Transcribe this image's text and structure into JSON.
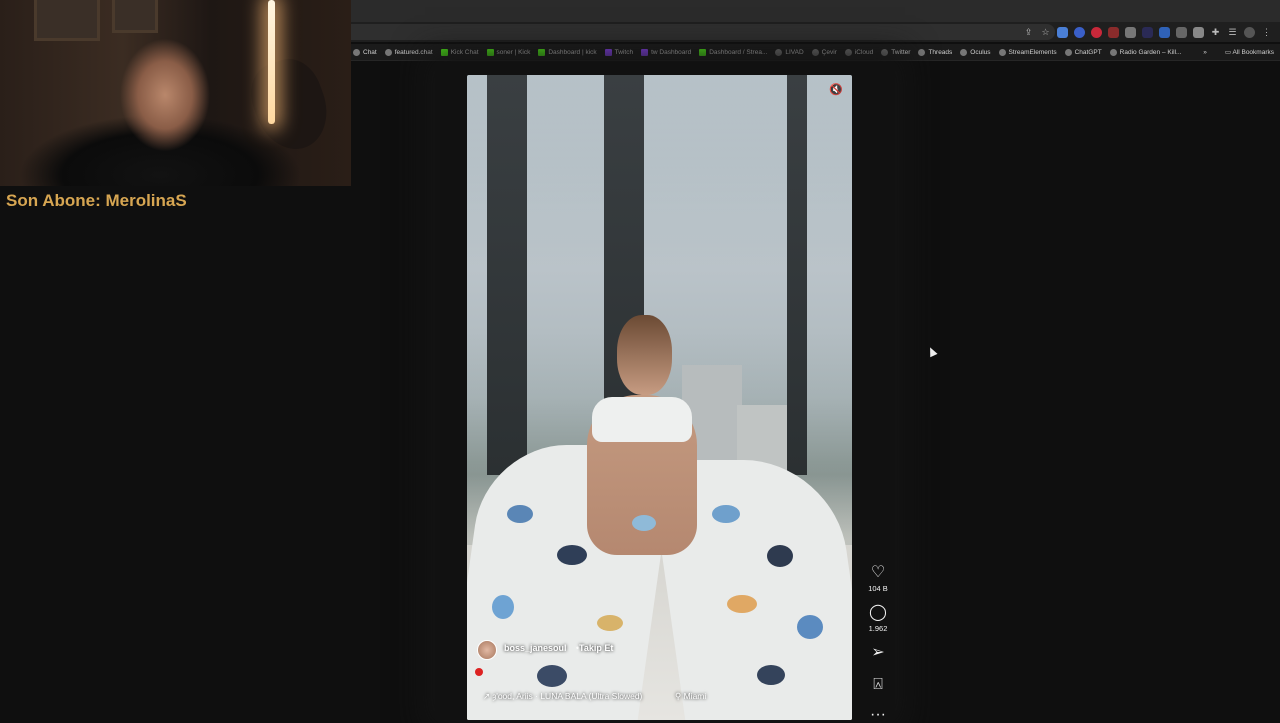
{
  "overlay": {
    "subscriber_label": "Son Abone: MerolinaS"
  },
  "bookmarks": {
    "items": [
      {
        "label": "Chat",
        "icon": "globe-icon"
      },
      {
        "label": "featured.chat",
        "icon": "globe-icon"
      },
      {
        "label": "Kick Chat",
        "icon": "kick-icon"
      },
      {
        "label": "soner | Kick",
        "icon": "kick-icon"
      },
      {
        "label": "Dashboard | kick",
        "icon": "kick-icon"
      },
      {
        "label": "Twitch",
        "icon": "twitch-icon"
      },
      {
        "label": "tw Dashboard",
        "icon": "twitch-icon"
      },
      {
        "label": "Dashboard / Strea...",
        "icon": "kick-icon"
      },
      {
        "label": "LIVAD",
        "icon": "globe-icon"
      },
      {
        "label": "Çevir",
        "icon": "translate-icon"
      },
      {
        "label": "iCloud",
        "icon": "apple-icon"
      },
      {
        "label": "Twitter",
        "icon": "globe-icon"
      },
      {
        "label": "Threads",
        "icon": "globe-icon"
      },
      {
        "label": "Oculus",
        "icon": "globe-icon"
      },
      {
        "label": "StreamElements",
        "icon": "globe-icon"
      },
      {
        "label": "ChatGPT",
        "icon": "globe-icon"
      },
      {
        "label": "Radio Garden – Kill...",
        "icon": "globe-icon"
      }
    ],
    "overflow": "»",
    "all_bookmarks": "All Bookmarks"
  },
  "post": {
    "username": "boss_janesoul",
    "separator": "•",
    "follow_label": "Takip Et",
    "music": "↗ ȝ'ood, Ariis · LUNA BALA (Ultra Slowed)",
    "location": "Miami"
  },
  "actions": {
    "likes": "104 B",
    "comments": "1.962"
  }
}
